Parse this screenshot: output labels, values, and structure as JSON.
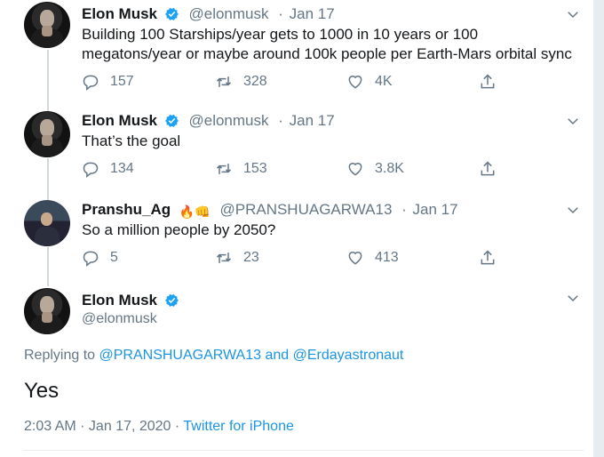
{
  "tweets": [
    {
      "name": "Elon Musk",
      "handle": "@elonmusk",
      "date": "Jan 17",
      "verified": true,
      "text": "Building 100 Starships/year gets to 1000 in 10 years or 100 megatons/year or maybe around 100k people per Earth-Mars orbital sync",
      "replies": "157",
      "retweets": "328",
      "likes": "4K"
    },
    {
      "name": "Elon Musk",
      "handle": "@elonmusk",
      "date": "Jan 17",
      "verified": true,
      "text": "That’s the goal",
      "replies": "134",
      "retweets": "153",
      "likes": "3.8K"
    },
    {
      "name": "Pranshu_Ag",
      "emoji": "🔥👊",
      "handle": "@PRANSHUAGARWA13",
      "date": "Jan 17",
      "verified": false,
      "text": "So a million people by 2050?",
      "replies": "5",
      "retweets": "23",
      "likes": "413"
    }
  ],
  "main_tweet": {
    "name": "Elon Musk",
    "handle": "@elonmusk",
    "replying_prefix": "Replying to",
    "replying_mention_1": "@PRANSHUAGARWA13",
    "replying_and": "and",
    "replying_mention_2": "@Erdayastronaut",
    "text": "Yes",
    "time": "2:03 AM · Jan 17, 2020 ·",
    "source": "Twitter for iPhone"
  },
  "icons": {
    "reply": "reply-icon",
    "retweet": "retweet-icon",
    "like": "heart-icon",
    "share": "share-icon",
    "caret": "chevron-down-icon",
    "verified": "verified-badge-icon"
  },
  "colors": {
    "link": "#1b95e0",
    "secondary_text": "#657786",
    "verified": "#1da1f2",
    "thread_line": "#cfd9de"
  }
}
